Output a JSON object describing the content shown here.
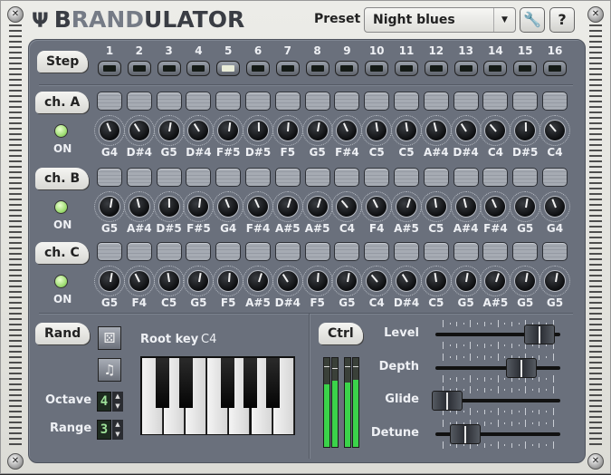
{
  "app": {
    "title_prefix_icon": "psi-logo-icon",
    "title_parts": [
      "B",
      "RAND",
      "ULATOR"
    ]
  },
  "header": {
    "preset_label": "Preset",
    "preset_value": "Night blues",
    "dropdown_icon": "chevron-down-icon",
    "tools_icon": "wrench-icon",
    "help_label": "?"
  },
  "step": {
    "label": "Step",
    "numbers": [
      "1",
      "2",
      "3",
      "4",
      "5",
      "6",
      "7",
      "8",
      "9",
      "10",
      "11",
      "12",
      "13",
      "14",
      "15",
      "16"
    ],
    "active_step": 5
  },
  "channels": [
    {
      "label": "ch. A",
      "on_label": "ON",
      "on": true,
      "notes": [
        "G4",
        "D#4",
        "G5",
        "D#4",
        "F#5",
        "D#5",
        "F5",
        "G5",
        "F#4",
        "C5",
        "C5",
        "A#4",
        "D#4",
        "C4",
        "D#5",
        "C4"
      ]
    },
    {
      "label": "ch. B",
      "on_label": "ON",
      "on": true,
      "notes": [
        "G5",
        "A#4",
        "D#5",
        "F#5",
        "G4",
        "F#4",
        "A#5",
        "A#5",
        "C4",
        "F4",
        "A#5",
        "C5",
        "A#4",
        "F#4",
        "G5",
        "G4"
      ]
    },
    {
      "label": "ch. C",
      "on_label": "ON",
      "on": true,
      "notes": [
        "G5",
        "F4",
        "C5",
        "G5",
        "F5",
        "A#5",
        "D#4",
        "F5",
        "G5",
        "C4",
        "D#4",
        "C5",
        "G5",
        "A#5",
        "G5",
        "G5"
      ]
    }
  ],
  "rand": {
    "label": "Rand",
    "dice_icon": "dice-icon",
    "note_icon": "music-note-icon",
    "root_key_label": "Root key",
    "root_key_value": "C4",
    "octave_label": "Octave",
    "octave_value": "4",
    "range_label": "Range",
    "range_value": "3"
  },
  "ctrl": {
    "label": "Ctrl",
    "meters": [
      {
        "level": 0.7,
        "peak": 0.9
      },
      {
        "level": 0.75,
        "peak": 0.88
      },
      {
        "level": 0.72,
        "peak": 0.9
      },
      {
        "level": 0.76,
        "peak": 0.9
      }
    ],
    "sliders": [
      {
        "label": "Level",
        "value": 0.87
      },
      {
        "label": "Depth",
        "value": 0.71
      },
      {
        "label": "Glide",
        "value": 0.05
      },
      {
        "label": "Detune",
        "value": 0.21
      }
    ]
  }
}
